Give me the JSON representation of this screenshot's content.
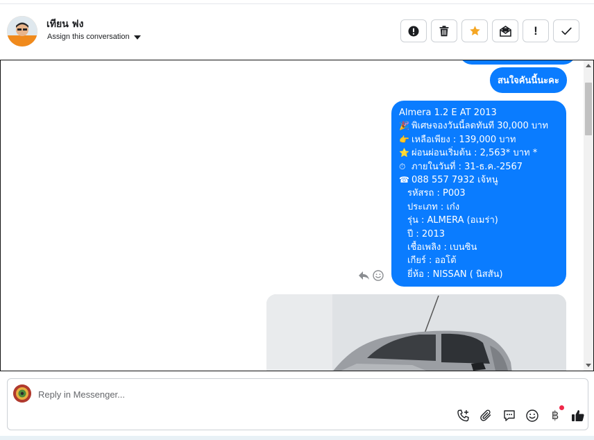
{
  "header": {
    "contact_name": "เทียน ฟง",
    "assign_label": "Assign this conversation",
    "actions": [
      {
        "name": "spam-alert",
        "icon": "exclamation-circle-icon"
      },
      {
        "name": "delete",
        "icon": "trash-icon"
      },
      {
        "name": "star",
        "icon": "star-icon"
      },
      {
        "name": "mark-unread",
        "icon": "envelope-icon"
      },
      {
        "name": "follow-up",
        "icon": "exclamation-icon",
        "glyph": "!"
      },
      {
        "name": "mark-done",
        "icon": "check-icon"
      }
    ]
  },
  "chat": {
    "messages": [
      {
        "text": "สนใจคันนี้นะคะ"
      },
      {
        "lines": [
          "Almera 1.2 E AT 2013",
          "พิเศษจองวันนี้ลดทันที 30,000 บาท",
          "เหลือเพียง : 139,000 บาท",
          "ผ่อนผ่อนเริ่มต้น : 2,563* บาท *",
          "ภายในวันที่ : 31-ธ.ค.-2567",
          "088 557 7932 เจ้หนู",
          "รหัสรถ : P003",
          "ประเภท : เก๋ง",
          "รุ่น : ALMERA (อเมร่า)",
          "ปี : 2013",
          "เชื้อเพลิง : เบนซิน",
          "เกียร์ : ออโต้",
          "ยี่ห้อ : NISSAN ( นิสสัน)"
        ],
        "line_icons": [
          "",
          "🎉",
          "👉",
          "⭐",
          "⏱",
          "☎",
          "",
          "",
          "",
          "",
          "",
          "",
          ""
        ]
      }
    ]
  },
  "reply": {
    "placeholder": "Reply in Messenger...",
    "currency_glyph": "฿"
  },
  "colors": {
    "bubble": "#0a7cff",
    "star": "#f5a623",
    "notification": "#f02849"
  }
}
